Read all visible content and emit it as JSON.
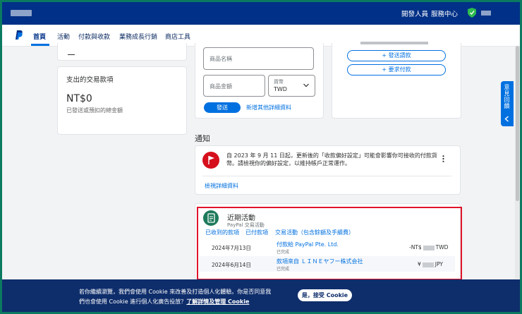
{
  "topbar": {
    "developer": "開發人員",
    "service_center": "服務中心"
  },
  "nav": {
    "tabs": [
      "首頁",
      "活動",
      "付款與收款",
      "業務成長行銷",
      "商店工具"
    ]
  },
  "left": {
    "sent_title": "支出的交易款項",
    "sent_amount": "NT$0",
    "sent_sub": "已發送或預扣的總金額"
  },
  "form": {
    "item_name_ph": "商品名稱",
    "item_amount_ph": "商品金額",
    "currency_label": "貨幣",
    "currency_value": "TWD",
    "send_button": "發送",
    "more_details": "新增其他詳細資料"
  },
  "right": {
    "request_link": "+ 發送請款",
    "request_payment": "+ 要求付款"
  },
  "sidetab": {
    "label": "意見回饋"
  },
  "notifications": {
    "header": "通知",
    "message": "自 2023 年 9 月 11 日起，更新後的「收款偏好設定」可能會影響你可接收的付款貨幣。請檢視你的偏好設定，以維持帳戶正常運作。",
    "view_details": "檢視詳細資料"
  },
  "recent": {
    "title": "近期活動",
    "subtitle": "PayPal 交易活動",
    "tabs": [
      "已收到的款項",
      "已付款項",
      "交易活動（包含餘額及手續費）"
    ],
    "rows": [
      {
        "date": "2024年7月13日",
        "name": "付款給 PayPal Pte. Ltd.",
        "status": "已完成",
        "amount_prefix": "-NT$",
        "amount_suffix": "TWD"
      },
      {
        "date": "2024年6月14日",
        "name": "款項來自 ＬＩＮＥヤフー株式会社",
        "status": "已完成",
        "amount_prefix": "¥",
        "amount_suffix": "JPY"
      }
    ]
  },
  "cookie": {
    "line1": "若你繼續瀏覽，我們會使用 Cookie 來改善及打造個人化體驗。你是否同意我",
    "line2_pre": "們也會使用 Cookie 進行個人化廣告投放？",
    "line2_link": "了解詳情及管理 Cookie",
    "accept": "是，接受 Cookie"
  },
  "colors": {
    "paypal_navy": "#003087",
    "paypal_blue": "#0070e0",
    "highlight_red": "#e0142b",
    "alert_red": "#d50f1c",
    "activity_green": "#1d7a5a"
  }
}
